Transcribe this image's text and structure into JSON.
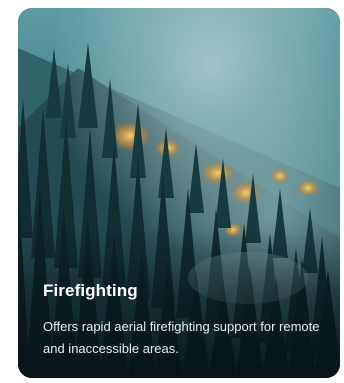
{
  "card": {
    "title": "Firefighting",
    "description": "Offers rapid aerial firefighting support for remote and inaccessible areas.",
    "image": "forest-wildfire-photo",
    "colors": {
      "sky": "#4f8f98",
      "smoke": "#8fb7bb",
      "forest": "#0f2a2e",
      "fire": "#e8b04a",
      "text": "#ffffff"
    }
  }
}
